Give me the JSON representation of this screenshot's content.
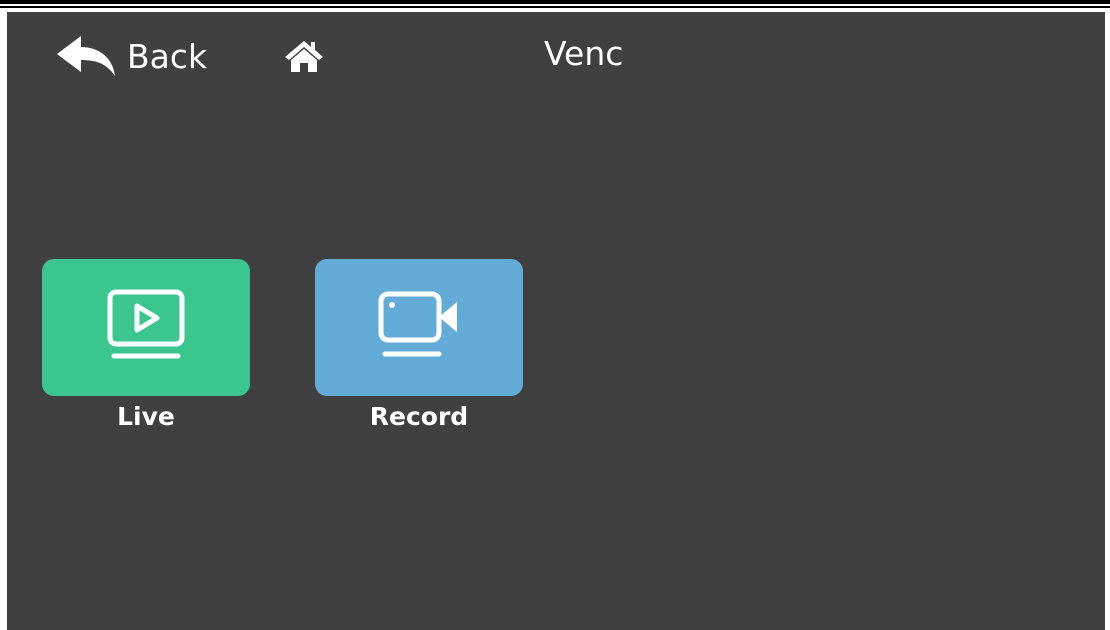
{
  "header": {
    "back_label": "Back",
    "back_icon": "reply-arrow-icon",
    "home_icon": "home-icon",
    "title": "Venc"
  },
  "tiles": [
    {
      "label": "Live",
      "icon": "play-screen-icon",
      "color": "#3cc68f"
    },
    {
      "label": "Record",
      "icon": "video-camera-icon",
      "color": "#64acd8"
    }
  ],
  "theme": {
    "background": "#404040",
    "text": "#ffffff"
  }
}
